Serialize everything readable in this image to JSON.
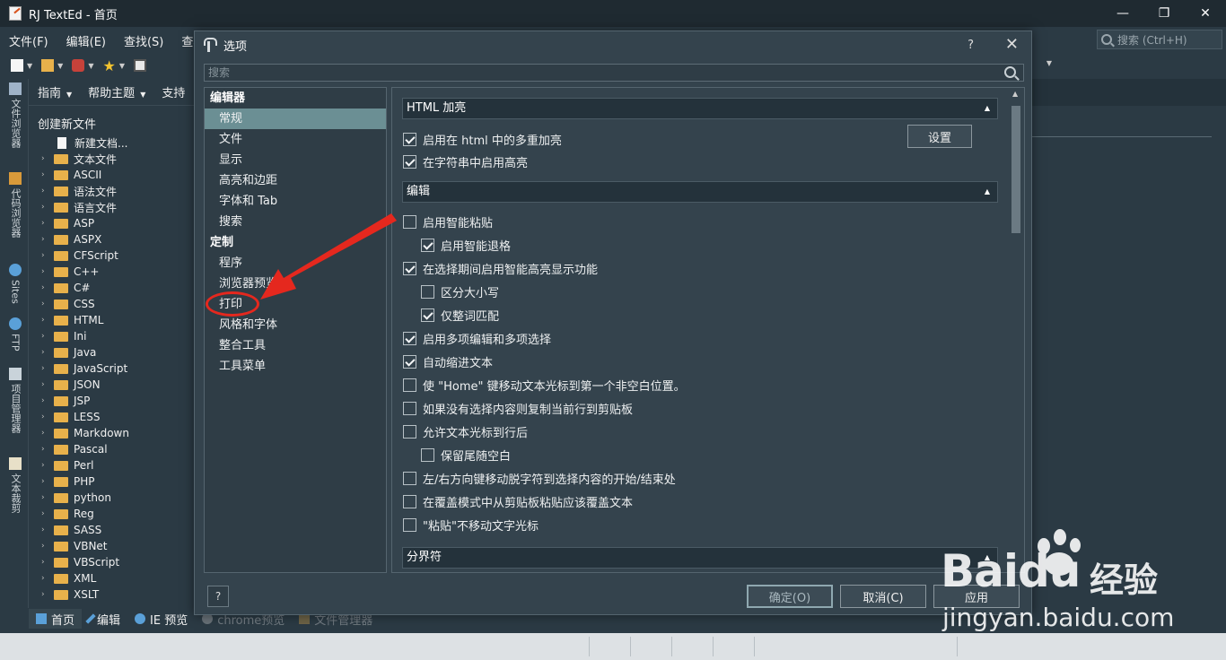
{
  "window": {
    "title": "RJ TextEd - 首页",
    "controls": [
      "—",
      "❐",
      "✕"
    ]
  },
  "menu": {
    "items": [
      "文件(F)",
      "编辑(E)",
      "查找(S)",
      "查看"
    ],
    "search_placeholder": "搜索 (Ctrl+H)"
  },
  "vertical_tabs": [
    "文件浏览器",
    "代码浏览器",
    "Sites",
    "FTP",
    "项目管理器",
    "文本裁剪"
  ],
  "explorer": {
    "tabs": [
      "指南",
      "帮助主题",
      "支持"
    ],
    "new_file_label": "创建新文件",
    "new_doc_label": "新建文档...",
    "folders": [
      "文本文件",
      "ASCII",
      "语法文件",
      "语言文件",
      "ASP",
      "ASPX",
      "CFScript",
      "C++",
      "C#",
      "CSS",
      "HTML",
      "Ini",
      "Java",
      "JavaScript",
      "JSON",
      "JSP",
      "LESS",
      "Markdown",
      "Pascal",
      "Perl",
      "PHP",
      "python",
      "Reg",
      "SASS",
      "VBNet",
      "VBScript",
      "XML",
      "XSLT"
    ]
  },
  "bottom_tabs": [
    "首页",
    "编辑",
    "IE 预览",
    "chrome预览",
    "文件管理器"
  ],
  "dialog": {
    "title": "选项",
    "help": "?",
    "close": "✕",
    "search_placeholder": "搜索",
    "categories": [
      {
        "type": "group",
        "label": "编辑器"
      },
      {
        "type": "item",
        "label": "常规",
        "selected": true
      },
      {
        "type": "item",
        "label": "文件"
      },
      {
        "type": "item",
        "label": "显示"
      },
      {
        "type": "item",
        "label": "高亮和边距"
      },
      {
        "type": "item",
        "label": "字体和 Tab"
      },
      {
        "type": "item",
        "label": "搜索"
      },
      {
        "type": "group",
        "label": "定制"
      },
      {
        "type": "item",
        "label": "程序"
      },
      {
        "type": "item",
        "label": "浏览器预览"
      },
      {
        "type": "item",
        "label": "打印"
      },
      {
        "type": "item",
        "label": "风格和字体"
      },
      {
        "type": "item",
        "label": "整合工具"
      },
      {
        "type": "item",
        "label": "工具菜单"
      }
    ],
    "sections": {
      "html_highlight": {
        "title": "HTML 加亮",
        "settings_button": "设置",
        "options": [
          {
            "label": "启用在 html 中的多重加亮",
            "checked": true
          },
          {
            "label": "在字符串中启用高亮",
            "checked": true
          }
        ]
      },
      "edit": {
        "title": "编辑",
        "options": [
          {
            "label": "启用智能粘贴",
            "checked": false
          },
          {
            "label": "启用智能退格",
            "checked": true
          },
          {
            "label": "在选择期间启用智能高亮显示功能",
            "checked": true
          },
          {
            "label": "区分大小写",
            "checked": false
          },
          {
            "label": "仅整词匹配",
            "checked": true
          },
          {
            "label": "启用多项编辑和多项选择",
            "checked": true
          },
          {
            "label": "自动缩进文本",
            "checked": true
          },
          {
            "label": "使 \"Home\" 键移动文本光标到第一个非空白位置。",
            "checked": false
          },
          {
            "label": "如果没有选择内容则复制当前行到剪贴板",
            "checked": false
          },
          {
            "label": "允许文本光标到行后",
            "checked": false
          },
          {
            "label": "保留尾随空白",
            "checked": false
          },
          {
            "label": "左/右方向键移动脱字符到选择内容的开始/结束处",
            "checked": false
          },
          {
            "label": "在覆盖模式中从剪贴板粘贴应该覆盖文本",
            "checked": false
          },
          {
            "label": "\"粘贴\"不移动文字光标",
            "checked": false
          }
        ]
      },
      "separator": {
        "title": "分界符"
      }
    },
    "buttons": {
      "ok": "确定(O)",
      "cancel": "取消(C)",
      "apply": "应用"
    }
  },
  "watermark": {
    "brand": "Bai",
    "brand2": "du",
    "subtitle": "经验",
    "url": "jingyan.baidu.com"
  },
  "colors": {
    "accent_selected": "#6b8f94",
    "annotation_red": "#e5281e"
  }
}
